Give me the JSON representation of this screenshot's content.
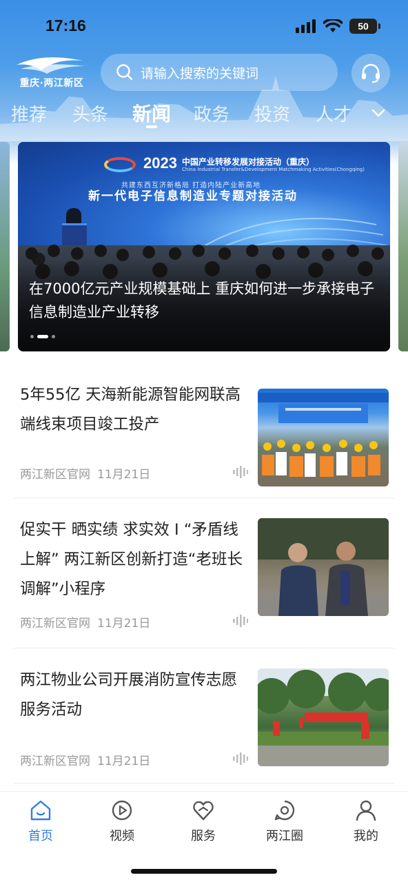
{
  "status_bar": {
    "time": "17:16",
    "battery": "50"
  },
  "header": {
    "logo_text": "重庆·两江新区",
    "search_placeholder": "请输入搜索的关键词",
    "tabs": [
      {
        "label": "推荐",
        "active": false
      },
      {
        "label": "头条",
        "active": false
      },
      {
        "label": "新闻",
        "active": true
      },
      {
        "label": "政务",
        "active": false
      },
      {
        "label": "投资",
        "active": false
      },
      {
        "label": "人才",
        "active": false
      }
    ]
  },
  "banner": {
    "event_year": "2023",
    "event_name": "中国产业转移发展对接活动（重庆）",
    "event_name_en": "China Industrial Transfer&Development Matchmaking Activities(Chongqing)",
    "slogan": "共建东西互济新格局   打造内陆产业新高地",
    "headline": "新一代电子信息制造业专题对接活动",
    "caption": "在7000亿元产业规模基础上 重庆如何进一步承接电子信息制造业产业转移",
    "dots": 3,
    "active_dot": 1
  },
  "news": [
    {
      "title": "5年55亿 天海新能源智能网联高端线束项目竣工投产",
      "source": "两江新区官网",
      "date": "11月21日"
    },
    {
      "title": "促实干 晒实绩 求实效 I “矛盾线上解” 两江新区创新打造“老班长调解”小程序",
      "source": "两江新区官网",
      "date": "11月21日"
    },
    {
      "title": "两江物业公司开展消防宣传志愿服务活动",
      "source": "两江新区官网",
      "date": "11月21日"
    }
  ],
  "bottom_nav": [
    {
      "label": "首页",
      "icon": "home-icon",
      "active": true
    },
    {
      "label": "视频",
      "icon": "video-play-icon",
      "active": false
    },
    {
      "label": "服务",
      "icon": "service-icon",
      "active": false
    },
    {
      "label": "两江圈",
      "icon": "circle-icon",
      "active": false
    },
    {
      "label": "我的",
      "icon": "person-icon",
      "active": false
    }
  ],
  "colors": {
    "accent": "#2f7fe0",
    "header_blue": "#3a8fe6"
  }
}
